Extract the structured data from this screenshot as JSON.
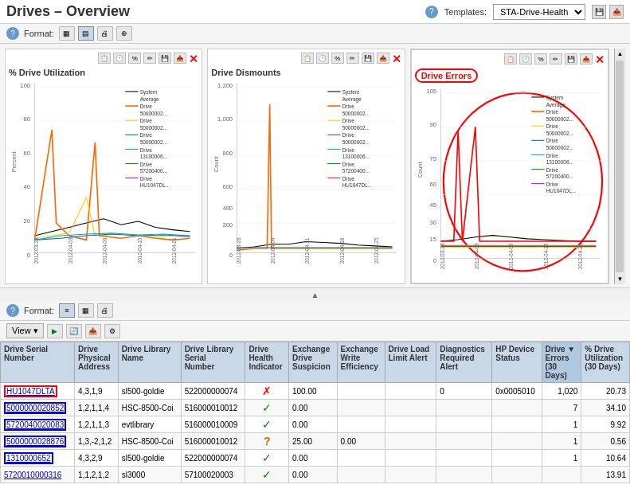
{
  "header": {
    "title": "Drives – Overview",
    "help_icon": "?",
    "templates_label": "Templates:",
    "template_value": "STA-Drive-Health",
    "save_icon": "💾",
    "export_icon": "📤"
  },
  "format_bar": {
    "label": "Format:",
    "icons": [
      "grid",
      "list",
      "print",
      "add"
    ]
  },
  "charts": [
    {
      "id": "chart-utilization",
      "title": "% Drive Utilization",
      "y_label": "Percent",
      "highlighted": false
    },
    {
      "id": "chart-dismounts",
      "title": "Drive Dismounts",
      "y_label": "Count",
      "highlighted": false
    },
    {
      "id": "chart-errors",
      "title": "Drive Errors",
      "y_label": "Count",
      "highlighted": true
    }
  ],
  "legend_items": [
    {
      "label": "System Average",
      "color": "#000000"
    },
    {
      "label": "Drive 500000002...",
      "color": "#ff8800"
    },
    {
      "label": "Drive 500000002...",
      "color": "#ffcc00"
    },
    {
      "label": "Drive 500000002...",
      "color": "#0066cc"
    },
    {
      "label": "Drive 131000006...",
      "color": "#00aacc"
    },
    {
      "label": "Drive 572004000...",
      "color": "#009900"
    },
    {
      "label": "Drive HU1047DL...",
      "color": "#cc00cc"
    }
  ],
  "lower_format": {
    "help_icon": "?",
    "label": "Format:",
    "icons": [
      "list",
      "grid",
      "print"
    ]
  },
  "toolbar": {
    "view_label": "View ▾",
    "icons": [
      "play",
      "refresh",
      "export",
      "settings"
    ]
  },
  "table": {
    "columns": [
      {
        "key": "serial",
        "label": "Drive Serial Number"
      },
      {
        "key": "physical",
        "label": "Drive Physical Address"
      },
      {
        "key": "library_name",
        "label": "Drive Library Name"
      },
      {
        "key": "library_serial",
        "label": "Drive Library Serial Number"
      },
      {
        "key": "health",
        "label": "Drive Health Indicator"
      },
      {
        "key": "exchange_suspicion",
        "label": "Exchange Drive Suspicion"
      },
      {
        "key": "write_efficiency",
        "label": "Exchange Write Efficiency"
      },
      {
        "key": "load_alert",
        "label": "Drive Load Limit Alert"
      },
      {
        "key": "diagnostics_alert",
        "label": "Diagnostics Required Alert"
      },
      {
        "key": "hp_status",
        "label": "HP Device Status"
      },
      {
        "key": "errors",
        "label": "Drive Errors (30 Days)",
        "sorted": true,
        "sort_dir": "desc"
      },
      {
        "key": "utilization",
        "label": "% Drive Utilization (30 Days)"
      }
    ],
    "rows": [
      {
        "serial": "HU1047DLTA",
        "serial_style": "red_border",
        "physical": "4,3,1,9",
        "library_name": "sl500-goldie",
        "library_serial": "522000000074",
        "health": "error",
        "exchange_suspicion": "100.00",
        "write_efficiency": "",
        "load_alert": "",
        "diagnostics_alert": "0",
        "hp_status": "0x0005010",
        "errors": "1,020",
        "utilization": "20.73"
      },
      {
        "serial": "5000000020852",
        "serial_style": "blue_border",
        "physical": "1,2,1,1,4",
        "library_name": "HSC-8500-Coi",
        "library_serial": "516000010012",
        "health": "ok",
        "exchange_suspicion": "0.00",
        "write_efficiency": "",
        "load_alert": "",
        "diagnostics_alert": "",
        "hp_status": "",
        "errors": "7",
        "utilization": "34.10"
      },
      {
        "serial": "5720040020083",
        "serial_style": "blue_border",
        "physical": "1,2,1,1,3",
        "library_name": "evtlibrary",
        "library_serial": "516000010009",
        "health": "ok",
        "exchange_suspicion": "0.00",
        "write_efficiency": "",
        "load_alert": "",
        "diagnostics_alert": "",
        "hp_status": "",
        "errors": "1",
        "utilization": "9.92"
      },
      {
        "serial": "5000000028876",
        "serial_style": "blue_border",
        "physical": "1,3,-2,1,2",
        "library_name": "HSC-8500-Coi",
        "library_serial": "516000010012",
        "health": "question",
        "exchange_suspicion": "25.00",
        "write_efficiency": "0.00",
        "load_alert": "",
        "diagnostics_alert": "",
        "hp_status": "",
        "errors": "1",
        "utilization": "0.56"
      },
      {
        "serial": "1310000652",
        "serial_style": "blue_border",
        "physical": "4,3,2,9",
        "library_name": "sl500-goldie",
        "library_serial": "522000000074",
        "health": "ok",
        "exchange_suspicion": "0.00",
        "write_efficiency": "",
        "load_alert": "",
        "diagnostics_alert": "",
        "hp_status": "",
        "errors": "1",
        "utilization": "10.64"
      },
      {
        "serial": "5720010000316",
        "serial_style": "none",
        "physical": "1,1,2,1,2",
        "library_name": "sl3000",
        "library_serial": "57100020003",
        "health": "ok",
        "exchange_suspicion": "0.00",
        "write_efficiency": "",
        "load_alert": "",
        "diagnostics_alert": "",
        "hp_status": "",
        "errors": "",
        "utilization": "13.91"
      }
    ]
  }
}
